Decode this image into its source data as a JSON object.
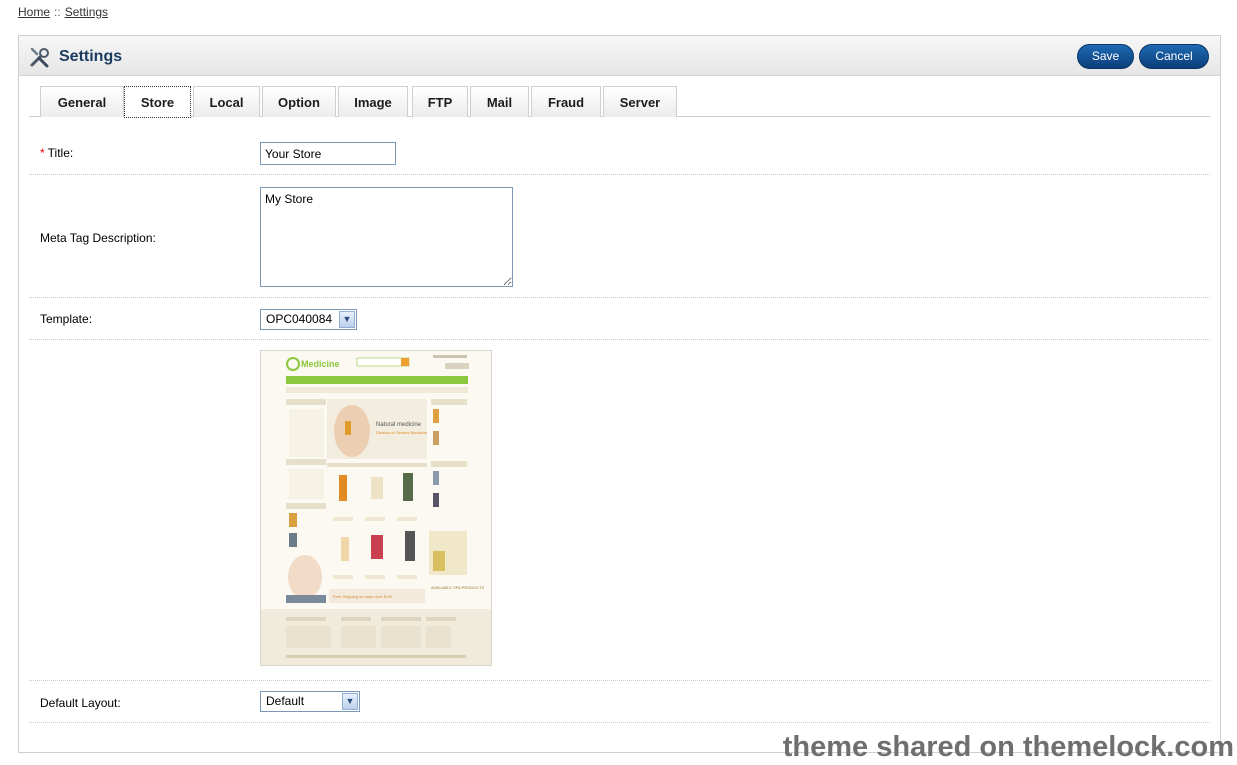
{
  "breadcrumb": {
    "home": "Home",
    "separator": "::",
    "settings": "Settings"
  },
  "header": {
    "title": "Settings",
    "icon": "settings-tools-icon",
    "save_label": "Save",
    "cancel_label": "Cancel"
  },
  "tabs": [
    {
      "label": "General"
    },
    {
      "label": "Store"
    },
    {
      "label": "Local"
    },
    {
      "label": "Option"
    },
    {
      "label": "Image"
    },
    {
      "label": "FTP"
    },
    {
      "label": "Mail"
    },
    {
      "label": "Fraud"
    },
    {
      "label": "Server"
    }
  ],
  "active_tab": "Store",
  "form": {
    "title_label": "Title:",
    "required_marker": "*",
    "title_value": "Your Store",
    "meta_label": "Meta Tag Description:",
    "meta_value": "My Store",
    "template_label": "Template:",
    "template_value": "OPC040084",
    "layout_label": "Default Layout:",
    "layout_value": "Default"
  },
  "preview": {
    "logo_text": "Medicine",
    "banner_title": "Natural medicine",
    "banner_subtitle": "Division of General Medicine",
    "shipping_text": "Free Shipping on order over $ 99",
    "spa_text": "AVAILABLE SPA PRODUCTS"
  },
  "watermark": "theme shared on themelock.com",
  "colors": {
    "accent": "#1a3b5f",
    "button": "#0c3e7a",
    "preview_green": "#8dc63f"
  }
}
